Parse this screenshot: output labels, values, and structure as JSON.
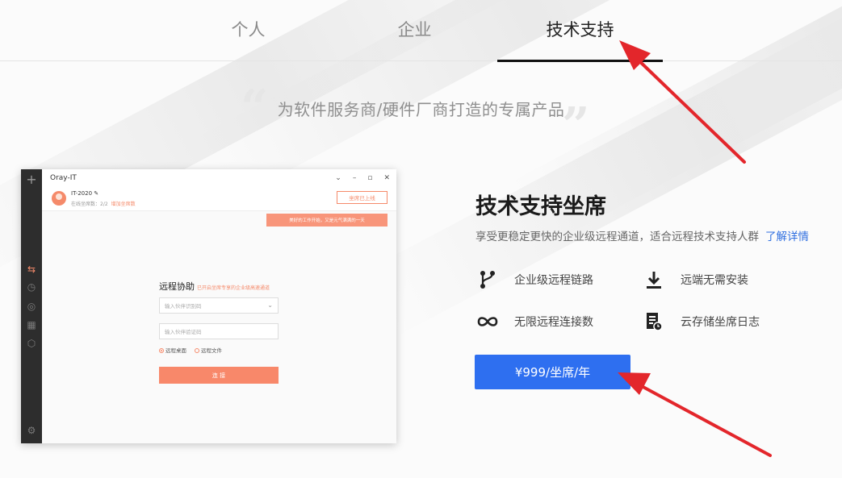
{
  "tabs": [
    {
      "label": "个人",
      "active": false
    },
    {
      "label": "企业",
      "active": false
    },
    {
      "label": "技术支持",
      "active": true
    }
  ],
  "slogan": "为软件服务商/硬件厂商打造的专属产品",
  "app_window": {
    "title": "Oray-IT",
    "user_name": "IT-2020",
    "online_label": "在线坐席数：2/2",
    "add_seat_link": "增加坐席数",
    "seat_button": "坐席已上线",
    "notice": "美好的工作开始，又是元气满满的一天",
    "remote_title": "远程协助",
    "remote_subtitle": "已开启坐席专享的企业级高速通道",
    "partner_id_placeholder": "输入伙伴识别码",
    "verify_code_placeholder": "输入伙伴验证码",
    "option_desktop": "远程桌面",
    "option_file": "远程文件",
    "connect_label": "连 接"
  },
  "product": {
    "title": "技术支持坐席",
    "description": "享受更稳定更快的企业级远程通道，适合远程技术支持人群",
    "more_link": "了解详情",
    "features": [
      {
        "icon": "branch-icon",
        "label": "企业级远程链路"
      },
      {
        "icon": "download-icon",
        "label": "远端无需安装"
      },
      {
        "icon": "infinity-icon",
        "label": "无限远程连接数"
      },
      {
        "icon": "log-icon",
        "label": "云存储坐席日志"
      }
    ],
    "price_button": "¥999/坐席/年"
  },
  "colors": {
    "accent_blue": "#2e6ff0",
    "app_orange": "#f8886a",
    "annotation_red": "#e3262b"
  }
}
